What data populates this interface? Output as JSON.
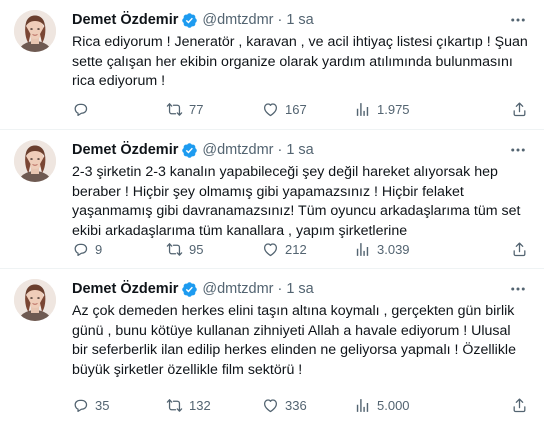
{
  "colors": {
    "verified": "#1d9bf0",
    "icon": "#536471",
    "text": "#0f1419"
  },
  "tweets": [
    {
      "name": "Demet Özdemir",
      "handle": "@dmtzdmr",
      "separator": "·",
      "time": "1 sa",
      "text": "Rica ediyorum ! Jeneratör , karavan , ve acil ihtiyaç listesi çıkartıp ! Şuan sette çalışan her ekibin organize olarak yardım atılımında bulunmasını rica ediyorum !",
      "replies": "",
      "retweets": "77",
      "likes": "167",
      "views": "1.975"
    },
    {
      "name": "Demet Özdemir",
      "handle": "@dmtzdmr",
      "separator": "·",
      "time": "1 sa",
      "text": "2-3 şirketin 2-3 kanalın yapabileceği şey değil hareket alıyorsak hep beraber ! Hiçbir şey olmamış gibi yapamazsınız ! Hiçbir felaket yaşanmamış gibi davranamazsınız! Tüm oyuncu arkadaşlarıma tüm set ekibi arkadaşlarıma tüm kanallara , yapım şirketlerine",
      "replies": "9",
      "retweets": "95",
      "likes": "212",
      "views": "3.039"
    },
    {
      "name": "Demet Özdemir",
      "handle": "@dmtzdmr",
      "separator": "·",
      "time": "1 sa",
      "text": "Az çok demeden herkes elini taşın altına koymalı , gerçekten gün birlik günü , bunu kötüye kullanan zihniyeti Allah a havale ediyorum ! Ulusal bir seferberlik ilan edilip herkes elinden ne geliyorsa yapmalı ! Özellikle büyük şirketler özellikle film sektörü !",
      "replies": "35",
      "retweets": "132",
      "likes": "336",
      "views": "5.000"
    }
  ],
  "icons": {
    "avatar": "profile-photo",
    "verified": "verified-badge-icon",
    "more": "more-dots-icon",
    "reply": "reply-icon",
    "retweet": "retweet-icon",
    "like": "heart-icon",
    "views": "views-chart-icon",
    "share": "share-icon"
  }
}
